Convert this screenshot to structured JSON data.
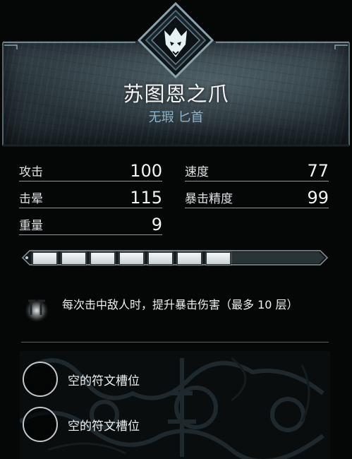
{
  "item": {
    "name": "苏图恩之爪",
    "subtitle": "无瑕 匕首",
    "emblem_icon": "wolf-crest-icon"
  },
  "stats": [
    {
      "label": "攻击",
      "value": "100"
    },
    {
      "label": "速度",
      "value": "77"
    },
    {
      "label": "击晕",
      "value": "115"
    },
    {
      "label": "暴击精度",
      "value": "99"
    },
    {
      "label": "重量",
      "value": "9"
    }
  ],
  "upgrade": {
    "filled_slots": 7,
    "total_slots": 7
  },
  "ability": {
    "icon": "rune-glyph-icon",
    "text": "每次击中敌人时，提升暴击伤害（最多 10 层）"
  },
  "runes": [
    {
      "label": "空的符文槽位"
    },
    {
      "label": "空的符文槽位"
    }
  ],
  "colors": {
    "background": "#060707",
    "accent_blue": "#8db6cc",
    "header_stone": "#2c393f"
  }
}
